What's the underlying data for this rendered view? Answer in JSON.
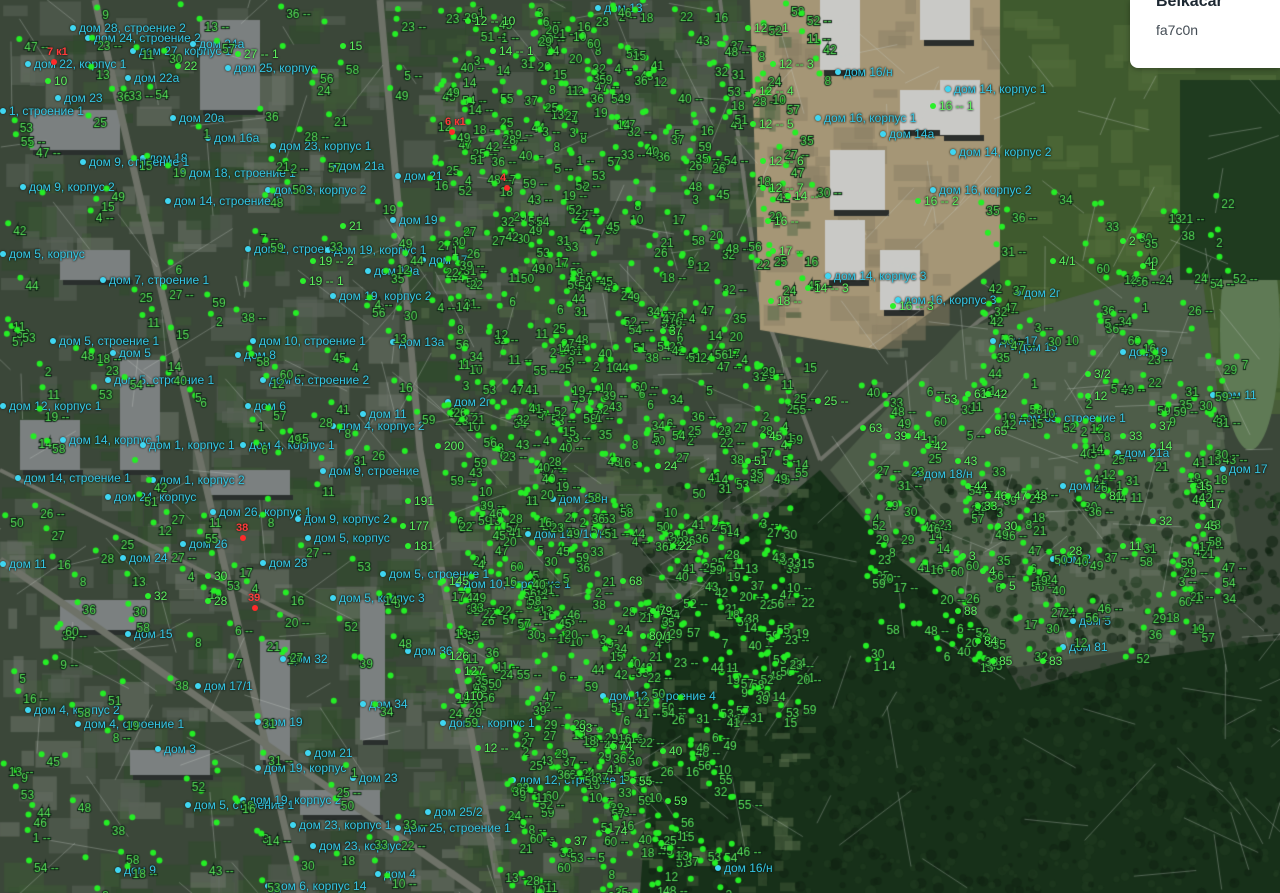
{
  "info_card": {
    "title": "Belkacar",
    "subtitle": "fa7c0n"
  },
  "colors": {
    "blue_marker": "#3fd6f2",
    "green_marker": "#2bf02b",
    "red_marker": "#ff2a2a",
    "forest": "#173019"
  },
  "red_markers": [
    {
      "label": "7 к1"
    },
    {
      "label": "6 к1"
    },
    {
      "label": "4"
    },
    {
      "label": "38"
    },
    {
      "label": "39"
    }
  ],
  "address_labels": [
    "дом 28, строение 2",
    "дом 24, строение 2",
    "дом 27, корпус 1",
    "дом 24а",
    "дом 22, корпус 1",
    "дом 22а",
    "дом 25, корпус",
    "дом 23",
    "1, строение 1",
    "дом 20а",
    "дом 16а",
    "дом 18",
    "дом 23, корпус 1",
    "дом 21а",
    "дом 9, строение 1",
    "дом 18, строение 1",
    "дом 9, корпус 2",
    "дом 21",
    "дом 23, корпус 2",
    "дом 14, строение 1",
    "дом 19",
    "дом 5, корпус",
    "дом 2, строение",
    "дом 19, корпус 1",
    "дом 17",
    "дом 7, строение 1",
    "дом 19а",
    "дом 19, корпус 2",
    "дом 5, строение 1",
    "дом 10, строение 1",
    "дом 13а",
    "дом 5",
    "дом 8",
    "дом 5, строение 1",
    "дом 6, строение 2",
    "дом 12, корпус 1",
    "дом 6",
    "дом 11",
    "дом 2г",
    "дом 4, корпус 2",
    "дом 14, корпус 1",
    "дом 1, корпус 1",
    "дом 4, корпус 1",
    "дом 14, строение 1",
    "дом 1, корпус 2",
    "дом 9, строение",
    "дом 24, корпус",
    "дом 26, корпус 1",
    "дом 9, корпус 2",
    "дом 26",
    "дом 24",
    "дом 5, корпус",
    "дом 28",
    "дом 11",
    "дом 5, строение 1",
    "дом 5, корпус 3",
    "дом 153/16/н",
    "дом 20/н",
    "дом 10, строение 1",
    "дом 15",
    "дом 32",
    "дом 36",
    "дом 17/1",
    "дом 4, корпус 2",
    "дом 4, строение 1",
    "дом 19",
    "дом 3",
    "дом 34",
    "дом 1, корпус 1",
    "дом 21",
    "дом 19, корпус",
    "дом 23",
    "дом 5, строение 1",
    "дом 19, корпус 2",
    "дом 25/2",
    "дом 25, строение 1",
    "дом 23, корпус 1",
    "дом 23, корпус",
    "дом 9",
    "дом 4",
    "дом 6, корпус 14",
    "дом 12, строение 1",
    "дом 12, строение 4",
    "дом 16/н",
    "дом 13",
    "дом 16/н",
    "дом 14, корпус 1",
    "дом 16, корпус 1",
    "дом 14а",
    "дом 14, корпус 2",
    "дом 16, корпус 2",
    "дом 14, корпус 3",
    "дом 16, корпус 3",
    "дом 17",
    "дом 15",
    "дом 19",
    "дом 11",
    "дом 65, строение 1",
    "дом 21а",
    "дом 17",
    "дом 86",
    "дом 2",
    "дом 5",
    "дом 81",
    "дом 18/н",
    "дом 2г"
  ],
  "green_numbers": [
    "12 -- 1",
    "12 -- 3",
    "12 -- 4",
    "12 -- 5",
    "12 -- 6",
    "12 -- 7",
    "14 --",
    "16 --",
    "17 --",
    "18 --",
    "16 -- 1",
    "16 -- 2",
    "16 -- 3",
    "14 -- 3",
    "25 --",
    "53",
    "61",
    "42",
    "65",
    "63",
    "39",
    "41",
    "42",
    "43",
    "44",
    "46",
    "47",
    "48",
    "30",
    "33",
    "37",
    "28",
    "32",
    "33",
    "200",
    "191",
    "181",
    "177",
    "145",
    "126",
    "127",
    "110",
    "93 --",
    "79",
    "80/1",
    "74",
    "68",
    "45",
    "51",
    "37",
    "24",
    "22",
    "3",
    "4",
    "5",
    "88",
    "84",
    "85",
    "83",
    "81",
    "1",
    "2",
    "4/1",
    "3/2",
    "12",
    "14",
    "15",
    "17",
    "45",
    "11 --",
    "19 -- 2",
    "19 -- 1",
    "21",
    "22",
    "27 -- 1",
    "15",
    "10",
    "12 -- 10",
    "14 -- 1",
    "32",
    "30",
    "28",
    "59",
    "74",
    "55",
    "40",
    "37",
    "12 --"
  ]
}
